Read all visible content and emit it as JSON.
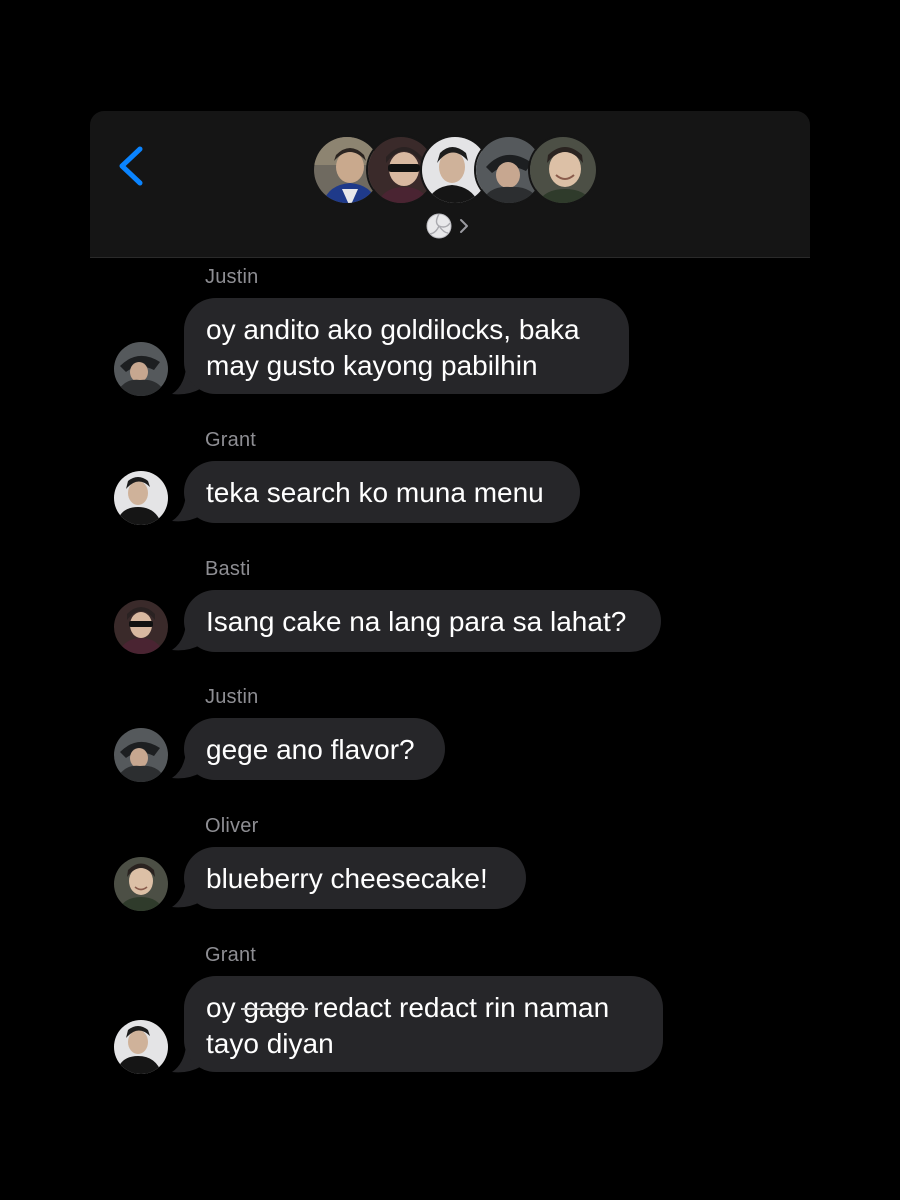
{
  "header": {
    "back_icon": "chevron-left-icon",
    "group_icon": "volleyball-icon",
    "group_chevron_icon": "chevron-right-icon",
    "accent_color": "#0a84ff"
  },
  "messages": [
    {
      "sender": "Justin",
      "avatar": "justin",
      "lines": "oy andito ako goldilocks, baka\nmay gusto kayong pabilhin"
    },
    {
      "sender": "Grant",
      "avatar": "grant",
      "lines": "teka search ko muna menu"
    },
    {
      "sender": "Basti",
      "avatar": "basti",
      "lines": "Isang cake na lang para sa lahat?"
    },
    {
      "sender": "Justin",
      "avatar": "justin",
      "lines": "gege ano flavor?"
    },
    {
      "sender": "Oliver",
      "avatar": "oliver",
      "lines": "blueberry cheesecake!"
    },
    {
      "sender": "Grant",
      "avatar": "grant",
      "pre": "oy ",
      "struck": "gago",
      "post": " redact redact rin naman\ntayo diyan"
    }
  ],
  "colors": {
    "bubble": "#262629",
    "sender_label": "#8e8e93",
    "header_bg": "#151515"
  }
}
